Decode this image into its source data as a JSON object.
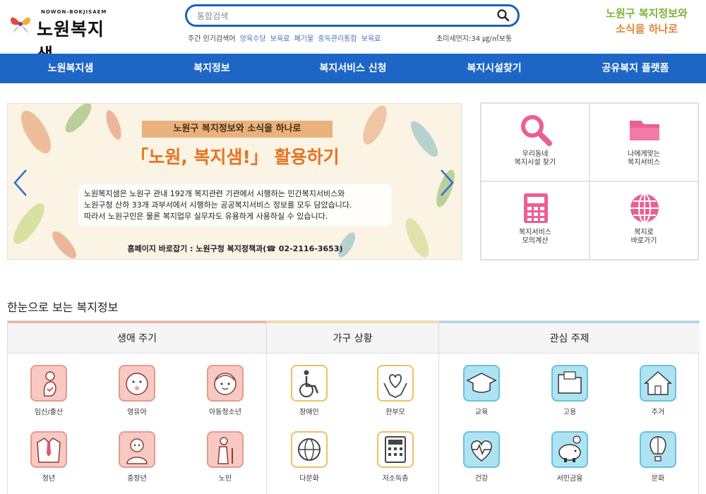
{
  "header": {
    "logo_en": "NOWON-BOKJISAEM",
    "logo_ko": "노원복지샘",
    "search_placeholder": "통합검색",
    "popular_label": "주간 인기검색어",
    "popular_keywords": [
      "양육수당",
      "보육료",
      "폐기물",
      "중독관리통합",
      "보육료"
    ],
    "dust_text": "초미세먼지:34 ㎍/㎥보통",
    "slogan_line1": "노원구 복지정보와",
    "slogan_line2": "소식을 하나로"
  },
  "nav": [
    "노원복지샘",
    "복지정보",
    "복지서비스 신청",
    "복지시설찾기",
    "공유복지 플랫폼"
  ],
  "banner": {
    "ribbon": "노원구 복지정보와 소식을 하나로",
    "title": "「노원, 복지샘!」 활용하기",
    "body_lines": [
      "노원복지샘은 노원구 관내 192개 복지관련 기관에서 시행하는 민간복지서비스와",
      "노원구청 산하 33개 과부서에서 시행하는 공공복지서비스 정보를 모두 담았습니다.",
      "따라서 노원구민은 물론 복지업무 실무자도 유용하게 사용하실 수 있습니다."
    ],
    "footer": "홈페이지 바로잡기 : 노원구청 복지정책과(☎ 02-2116-3653)"
  },
  "quick_links": [
    {
      "lines": [
        "우리동네",
        "복지시설 찾기"
      ],
      "icon": "search-icon"
    },
    {
      "lines": [
        "나에게맞는",
        "복지서비스"
      ],
      "icon": "folder-icon"
    },
    {
      "lines": [
        "복지서비스",
        "모의계산"
      ],
      "icon": "calculator-icon"
    },
    {
      "lines": [
        "복지로",
        "바로가기"
      ],
      "icon": "globe-icon"
    }
  ],
  "section_title": "한눈으로 보는 복지정보",
  "columns": [
    {
      "title": "생애 주기",
      "items": [
        "임신/출산",
        "영유아",
        "아동청소년",
        "청년",
        "중장년",
        "노인"
      ]
    },
    {
      "title": "가구 상황",
      "items": [
        "장애인",
        "한부모",
        "다문화",
        "저소득층"
      ]
    },
    {
      "title": "관심 주제",
      "items": [
        "교육",
        "고용",
        "주거",
        "건강",
        "서민금융",
        "문화"
      ]
    }
  ],
  "colors": {
    "nav": "#1e66c6",
    "accent_orange": "#e47422",
    "search_border": "#1f5fc0"
  }
}
